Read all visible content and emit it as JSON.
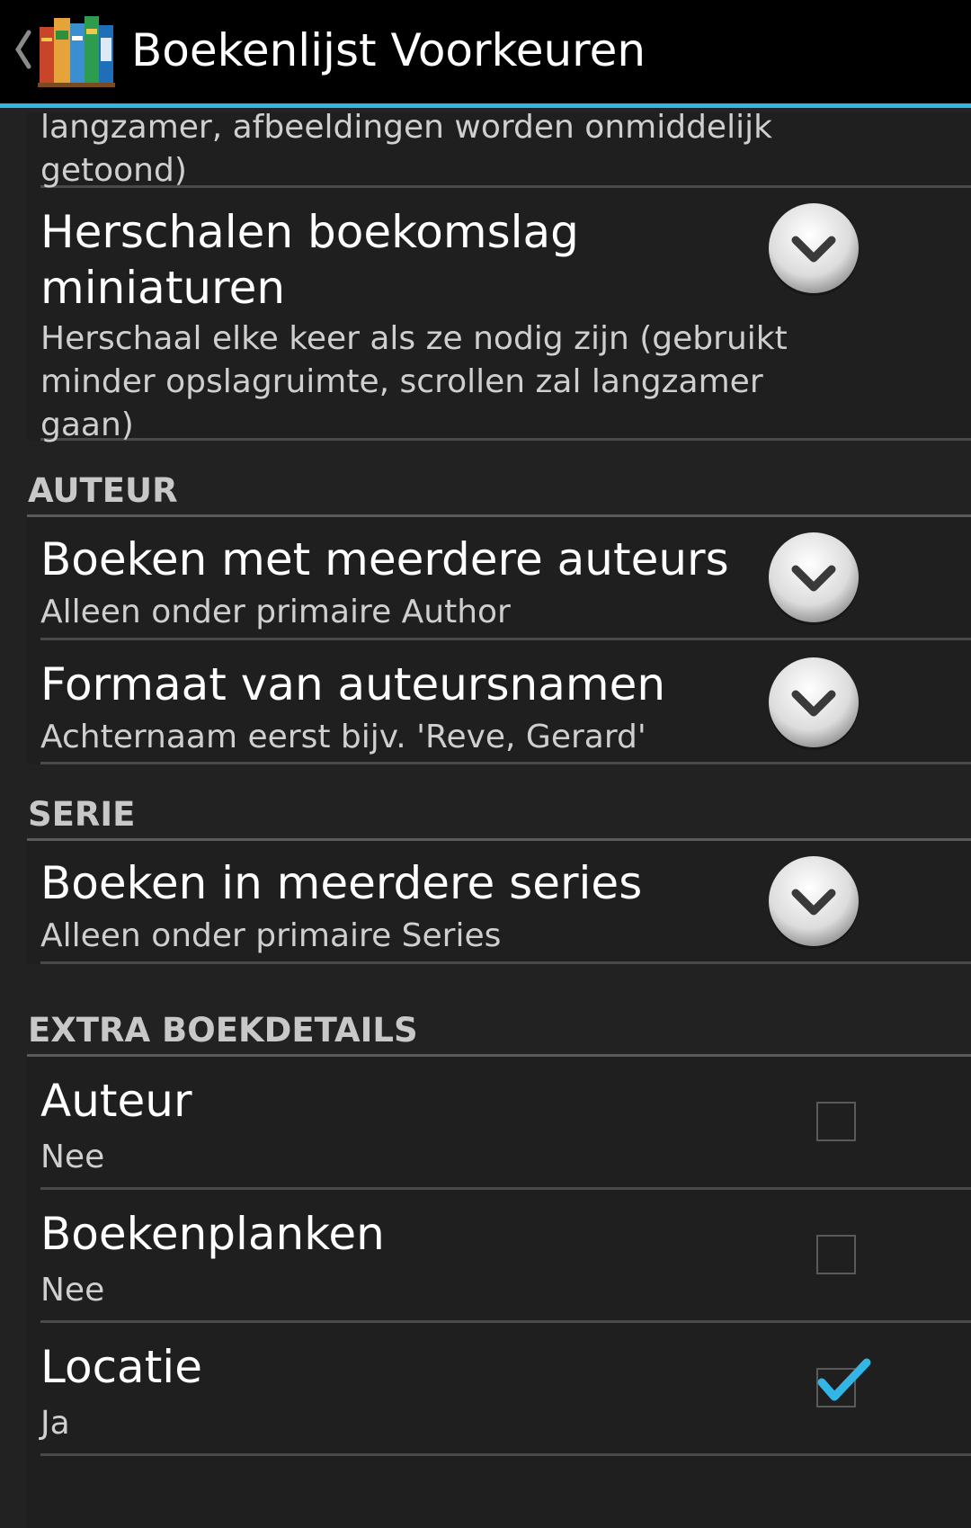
{
  "actionbar": {
    "title": "Boekenlijst Voorkeuren",
    "back_icon": "chevron-left-icon",
    "app_icon": "books-icon",
    "accent_color": "#33b5e5"
  },
  "top_partial": {
    "summary": "langzamer, afbeeldingen worden onmiddelijk getoond)"
  },
  "resize": {
    "title": "Herschalen boekomslag miniaturen",
    "summary": "Herschaal elke keer als ze nodig zijn (gebruikt minder opslagruimte, scrollen zal langzamer gaan)"
  },
  "categories": {
    "author": "AUTEUR",
    "series": "SERIE",
    "extra": "EXTRA BOEKDETAILS"
  },
  "author_prefs": [
    {
      "title": "Boeken met meerdere auteurs",
      "summary": "Alleen onder primaire Author"
    },
    {
      "title": "Formaat van auteursnamen",
      "summary": "Achternaam eerst bijv. 'Reve, Gerard'"
    }
  ],
  "series_prefs": [
    {
      "title": "Boeken in meerdere series",
      "summary": "Alleen onder primaire Series"
    }
  ],
  "extra_prefs": [
    {
      "title": "Auteur",
      "summary": "Nee",
      "checked": false
    },
    {
      "title": "Boekenplanken",
      "summary": "Nee",
      "checked": false
    },
    {
      "title": "Locatie",
      "summary": "Ja",
      "checked": true
    }
  ]
}
